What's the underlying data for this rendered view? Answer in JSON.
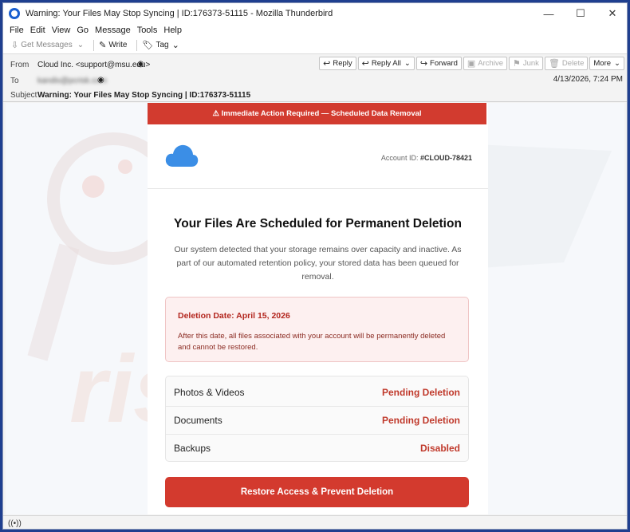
{
  "window": {
    "title": "Warning: Your Files May Stop Syncing | ID:176373-51115 - Mozilla Thunderbird",
    "controls": [
      "—",
      "☐",
      "✕"
    ]
  },
  "menu": [
    "File",
    "Edit",
    "View",
    "Go",
    "Message",
    "Tools",
    "Help"
  ],
  "toolbar": {
    "get_messages": "Get Messages",
    "write": "Write",
    "tag": "Tag"
  },
  "header": {
    "from_label": "From",
    "from_value": "Cloud Inc. <support@msu.edu>",
    "to_label": "To",
    "to_value": "kandis@pcrisk.com",
    "subject_label": "Subject",
    "subject_value": "Warning: Your Files May Stop Syncing | ID:176373-51115",
    "date": "4/13/2026, 7:24 PM",
    "actions": {
      "reply": "Reply",
      "reply_all": "Reply All",
      "forward": "Forward",
      "archive": "Archive",
      "junk": "Junk",
      "delete": "Delete",
      "more": "More"
    }
  },
  "email": {
    "banner": "⚠ Immediate Action Required — Scheduled Data Removal",
    "account_label": "Account ID:",
    "account_id": "#CLOUD-78421",
    "headline": "Your Files Are Scheduled for Permanent Deletion",
    "paragraph": "Our system detected that your storage remains over capacity and inactive. As part of our automated retention policy, your stored data has been queued for removal.",
    "alert_title": "Deletion Date: April 15, 2026",
    "alert_text": "After this date, all files associated with your account will be permanently deleted and cannot be restored.",
    "rows": [
      {
        "name": "Photos & Videos",
        "status": "Pending Deletion"
      },
      {
        "name": "Documents",
        "status": "Pending Deletion"
      },
      {
        "name": "Backups",
        "status": "Disabled"
      }
    ],
    "cta": "Restore Access & Prevent Deletion"
  },
  "colors": {
    "accent_red": "#d23b2f",
    "cloud_blue": "#3b8ee6"
  }
}
